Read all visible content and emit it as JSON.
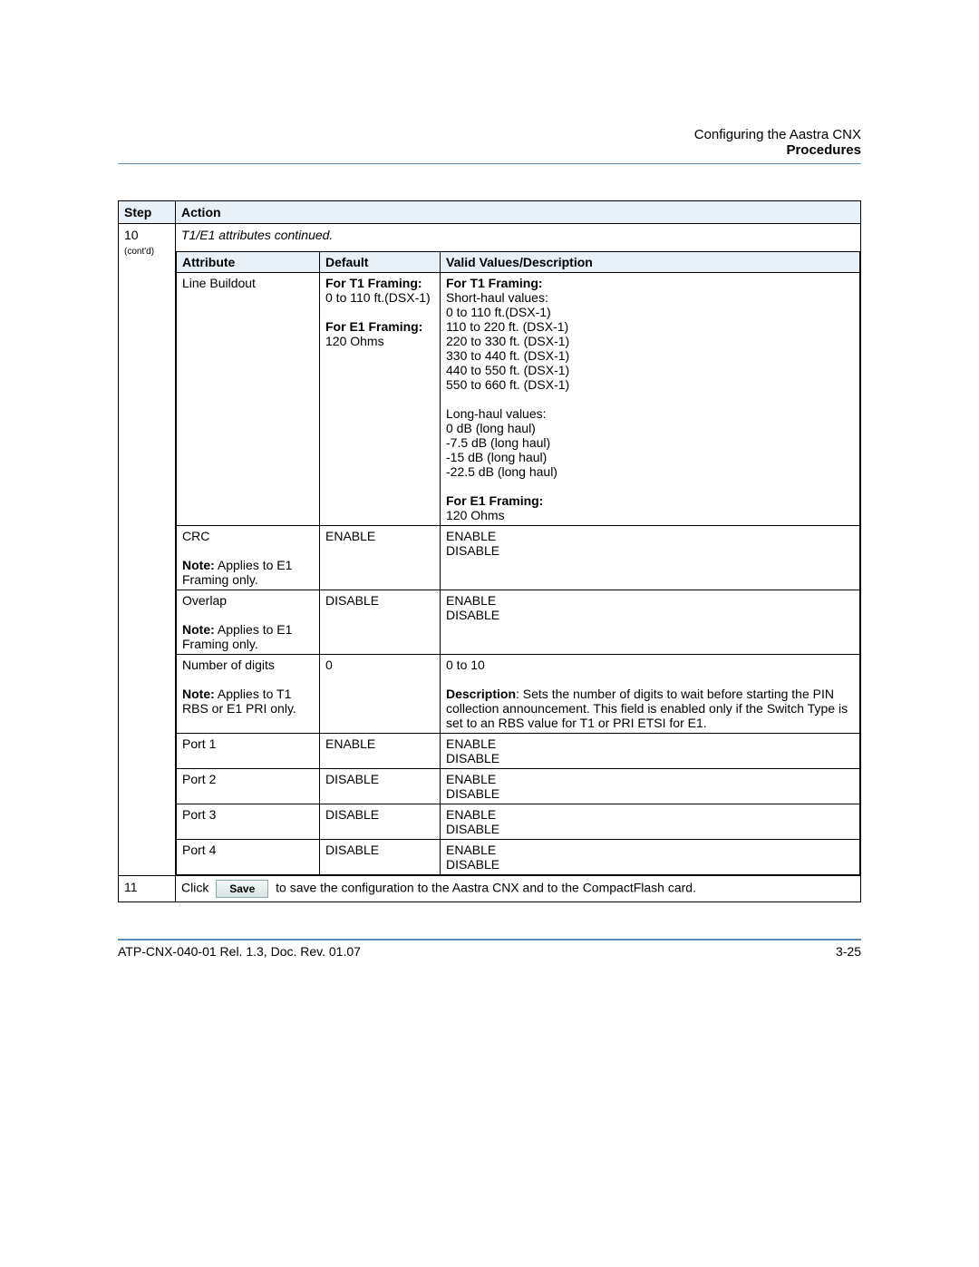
{
  "header": {
    "line1": "Configuring the Aastra CNX",
    "line2": "Procedures"
  },
  "outer_headers": {
    "step": "Step",
    "action": "Action"
  },
  "step10": {
    "number": "10",
    "contd": "(cont'd)",
    "intro": "T1/E1 attributes continued."
  },
  "inner_headers": {
    "attribute": "Attribute",
    "default": "Default",
    "valid": "Valid Values/Description"
  },
  "rows": {
    "line_buildout": {
      "attr": "Line Buildout",
      "def_t1_label": "For T1 Framing:",
      "def_t1_val": "0 to 110 ft.(DSX-1)",
      "def_e1_label": "For E1 Framing:",
      "def_e1_val": "120 Ohms",
      "v_t1_label": "For T1 Framing:",
      "v_short_label": "Short-haul values:",
      "v_s1": "0 to 110 ft.(DSX-1)",
      "v_s2": "110 to 220 ft. (DSX-1)",
      "v_s3": "220 to 330 ft. (DSX-1)",
      "v_s4": "330 to 440 ft. (DSX-1)",
      "v_s5": "440 to 550 ft. (DSX-1)",
      "v_s6": "550 to 660 ft. (DSX-1)",
      "v_long_label": "Long-haul values:",
      "v_l1": "0 dB (long haul)",
      "v_l2": "-7.5 dB (long haul)",
      "v_l3": "-15 dB (long haul)",
      "v_l4": "-22.5 dB (long haul)",
      "v_e1_label": "For E1 Framing:",
      "v_e1_val": "120 Ohms"
    },
    "crc": {
      "attr": "CRC",
      "note_label": "Note:",
      "note_text": " Applies to E1 Framing only.",
      "def": "ENABLE",
      "v1": "ENABLE",
      "v2": "DISABLE"
    },
    "overlap": {
      "attr": "Overlap",
      "note_label": "Note:",
      "note_text": " Applies to E1 Framing only.",
      "def": "DISABLE",
      "v1": "ENABLE",
      "v2": "DISABLE"
    },
    "num_digits": {
      "attr": "Number of digits",
      "note_label": "Note:",
      "note_text": " Applies to T1 RBS or E1 PRI only.",
      "def": "0",
      "v_range": "0 to 10",
      "desc_label": "Description",
      "desc_text": ": Sets the number of digits to wait before starting the PIN collection announcement. This field is enabled only if the Switch Type is set to an RBS value for T1 or PRI ETSI for E1."
    },
    "port1": {
      "attr": "Port 1",
      "def": "ENABLE",
      "v1": "ENABLE",
      "v2": "DISABLE"
    },
    "port2": {
      "attr": "Port 2",
      "def": "DISABLE",
      "v1": "ENABLE",
      "v2": "DISABLE"
    },
    "port3": {
      "attr": "Port 3",
      "def": "DISABLE",
      "v1": "ENABLE",
      "v2": "DISABLE"
    },
    "port4": {
      "attr": "Port 4",
      "def": "DISABLE",
      "v1": "ENABLE",
      "v2": "DISABLE"
    }
  },
  "step11": {
    "number": "11",
    "click": "Click",
    "save": "Save",
    "rest": "to save the configuration to the Aastra CNX and to the CompactFlash card."
  },
  "footer": {
    "left": "ATP-CNX-040-01 Rel. 1.3, Doc. Rev. 01.07",
    "right": "3-25"
  }
}
